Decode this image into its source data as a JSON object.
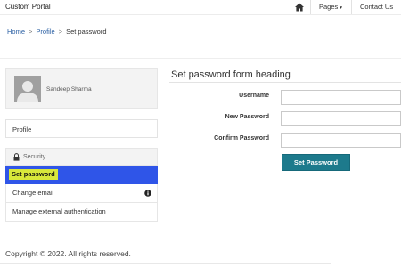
{
  "header": {
    "brand": "Custom Portal",
    "home_icon": "home-icon",
    "pages_label": "Pages",
    "pages_caret": "▾",
    "contact_label": "Contact Us"
  },
  "breadcrumb": {
    "items": [
      "Home",
      "Profile"
    ],
    "separator": ">",
    "current": "Set password"
  },
  "profile": {
    "name": "Sandeep Sharma",
    "avatar_icon": "avatar-placeholder-icon",
    "link_label": "Profile"
  },
  "security_nav": {
    "heading": "Security",
    "heading_icon": "lock-icon",
    "items": [
      {
        "label": "Set password",
        "active": true
      },
      {
        "label": "Change email",
        "icon": "info-icon"
      },
      {
        "label": "Manage external authentication"
      }
    ]
  },
  "form": {
    "heading": "Set password form heading",
    "fields": [
      {
        "label": "Username",
        "value": ""
      },
      {
        "label": "New Password",
        "value": ""
      },
      {
        "label": "Confirm Password",
        "value": ""
      }
    ],
    "submit_label": "Set Password"
  },
  "footer": {
    "copyright": "Copyright © 2022. All rights reserved."
  },
  "colors": {
    "active_nav": "#2f55e8",
    "highlight": "#d8e83a",
    "button": "#1d7a8c",
    "link": "#2a5fa3"
  }
}
